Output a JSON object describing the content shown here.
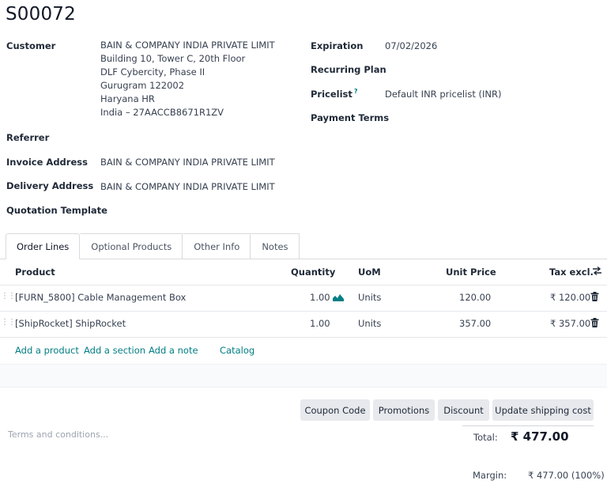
{
  "record": {
    "title": "S00072"
  },
  "left_fields": {
    "customer_label": "Customer",
    "customer_lines": [
      "BAIN & COMPANY INDIA PRIVATE LIMIT",
      "Building 10, Tower C, 20th Floor",
      "DLF Cybercity, Phase II",
      "Gurugram 122002",
      "Haryana HR",
      "India – 27AACCB8671R1ZV"
    ],
    "referrer_label": "Referrer",
    "invoice_label": "Invoice Address",
    "invoice_value": "BAIN & COMPANY INDIA PRIVATE LIMIT",
    "delivery_label": "Delivery Address",
    "delivery_value": "BAIN & COMPANY INDIA PRIVATE LIMIT",
    "template_label": "Quotation Template"
  },
  "right_fields": {
    "expiration_label": "Expiration",
    "expiration_value": "07/02/2026",
    "recurring_label": "Recurring Plan",
    "pricelist_label": "Pricelist",
    "pricelist_help": "?",
    "pricelist_value": "Default INR pricelist (INR)",
    "payment_terms_label": "Payment Terms"
  },
  "tabs": [
    {
      "label": "Order Lines"
    },
    {
      "label": "Optional Products"
    },
    {
      "label": "Other Info"
    },
    {
      "label": "Notes"
    }
  ],
  "table": {
    "headers": {
      "product": "Product",
      "quantity": "Quantity",
      "uom": "UoM",
      "unit_price": "Unit Price",
      "tax_excl": "Tax excl."
    },
    "rows": [
      {
        "product": "[FURN_5800] Cable Management Box",
        "quantity": "1.00",
        "uom": "Units",
        "unit_price": "120.00",
        "subtotal": "₹ 120.00"
      },
      {
        "product": "[ShipRocket] ShipRocket",
        "quantity": "1.00",
        "uom": "Units",
        "unit_price": "357.00",
        "subtotal": "₹ 357.00"
      }
    ],
    "actions": {
      "add_product": "Add a product",
      "add_section": "Add a section",
      "add_note": "Add a note",
      "catalog": "Catalog"
    }
  },
  "buttons": {
    "coupon": "Coupon Code",
    "promotions": "Promotions",
    "discount": "Discount",
    "shipping": "Update shipping cost"
  },
  "footer": {
    "terms_placeholder": "Terms and conditions...",
    "total_label": "Total:",
    "total_value": "₹ 477.00",
    "margin_label": "Margin:",
    "margin_value": "₹ 477.00 (100%)"
  },
  "colors": {
    "accent": "#017e84",
    "button_bg": "#e7e9ed",
    "border": "#d8dadd"
  }
}
